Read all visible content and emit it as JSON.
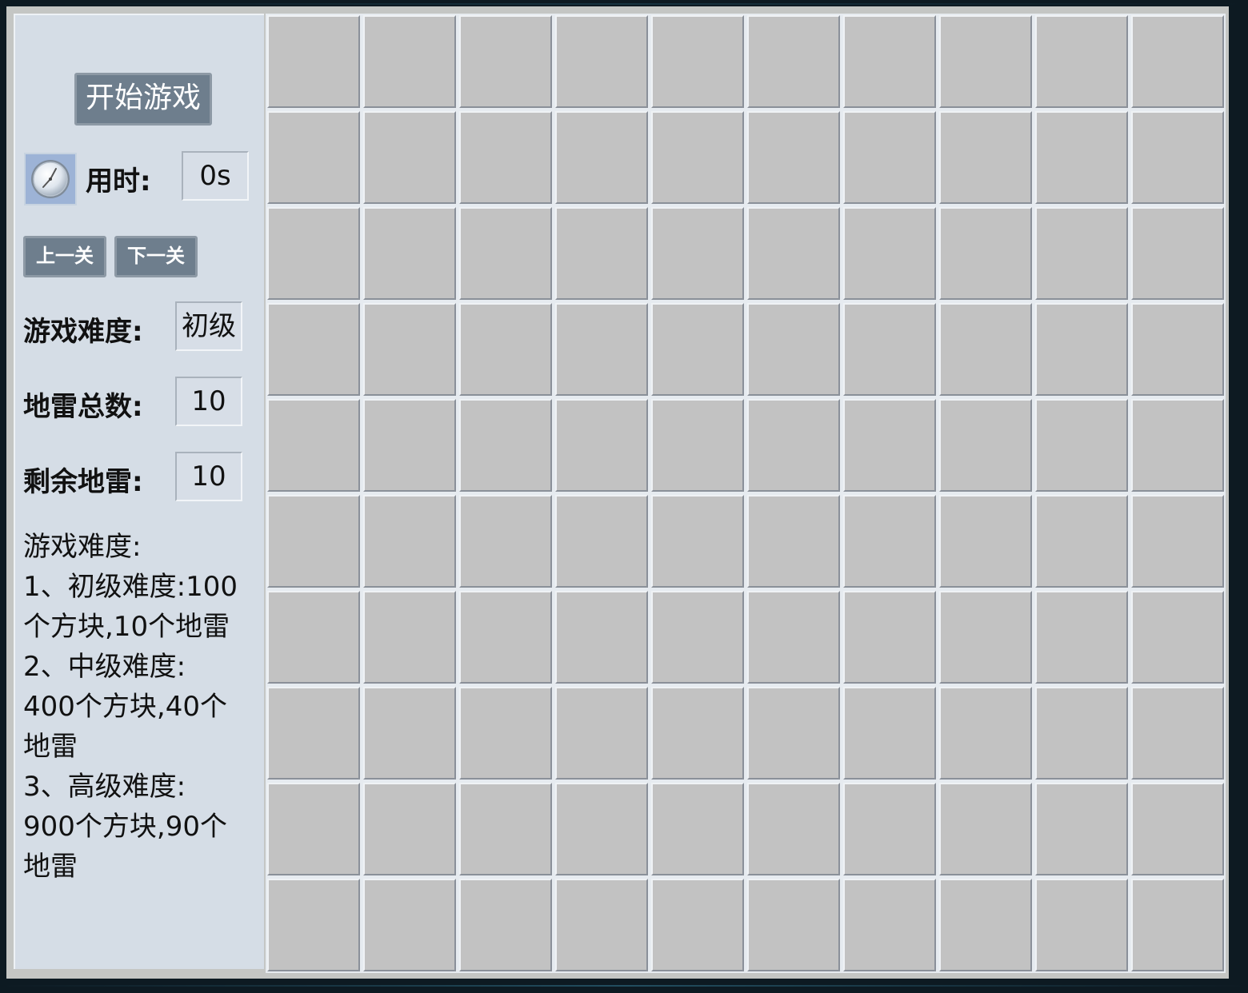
{
  "sidebar": {
    "start_button": "开始游戏",
    "timer_label": "用时:",
    "timer_value": "0s",
    "prev_level_button": "上一关",
    "next_level_button": "下一关",
    "difficulty_label": "游戏难度:",
    "difficulty_value": "初级",
    "total_mines_label": "地雷总数:",
    "total_mines_value": "10",
    "remaining_mines_label": "剩余地雷:",
    "remaining_mines_value": "10",
    "description_lines": [
      "游戏难度:",
      "1、初级难度:100",
      "个方块,10个地雷",
      "2、中级难度:",
      "400个方块,40个",
      "地雷",
      "3、高级难度:",
      "900个方块,90个",
      "地雷"
    ],
    "clock_icon": "clock-icon"
  },
  "board": {
    "rows": 10,
    "cols": 10,
    "cell_state": "unrevealed",
    "cell_color": "#c2c2c2"
  },
  "colors": {
    "button_bg": "#6e7e8d",
    "sidebar_bg": "#d5dde6",
    "frame_bg": "#c4c6c4"
  }
}
